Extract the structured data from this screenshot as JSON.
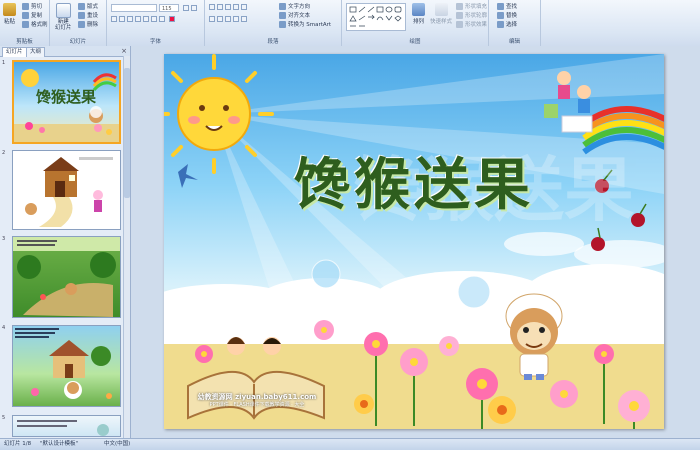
{
  "ribbon": {
    "clipboard": {
      "paste": "粘贴",
      "cut": "剪切",
      "copy": "复制",
      "format_painter": "格式刷",
      "label": "剪贴板"
    },
    "slides": {
      "new_slide": "新建\n幻灯片",
      "layout": "版式",
      "reset": "重设",
      "delete": "删除",
      "label": "幻灯片"
    },
    "font": {
      "font_size": "115",
      "label": "字体"
    },
    "paragraph": {
      "text_direction": "文字方向",
      "align_text": "对齐文本",
      "smartart": "转换为 SmartArt",
      "label": "段落"
    },
    "drawing": {
      "arrange": "排列",
      "quick_styles": "快速样式",
      "shape_fill": "形状填充",
      "shape_outline": "形状轮廓",
      "shape_effects": "形状效果",
      "label": "绘图"
    },
    "editing": {
      "find": "查找",
      "replace": "替换",
      "select": "选择",
      "label": "编辑"
    }
  },
  "panel": {
    "tab_slides": "幻灯片",
    "tab_outline": "大纲",
    "close": "×",
    "thumbs": [
      {
        "num": "1"
      },
      {
        "num": "2"
      },
      {
        "num": "3"
      },
      {
        "num": "4"
      },
      {
        "num": "5"
      }
    ],
    "thumb1_title": "馋猴送果"
  },
  "slide": {
    "title": "馋猴送果",
    "watermark_site": "幼教资源网 ziyuan.baby611.com",
    "watermark_sub": "PPT课件 · FLASH课件下载教学资源 · 大全"
  },
  "status": {
    "slide_counter": "幻灯片 1/8",
    "theme": "\"默认设计模板\"",
    "language": "中文(中国)"
  },
  "colors": {
    "title_green": "#2e5e1e",
    "ribbon_bg": "#dbe6f4",
    "thumb_selected": "#f5a623"
  }
}
